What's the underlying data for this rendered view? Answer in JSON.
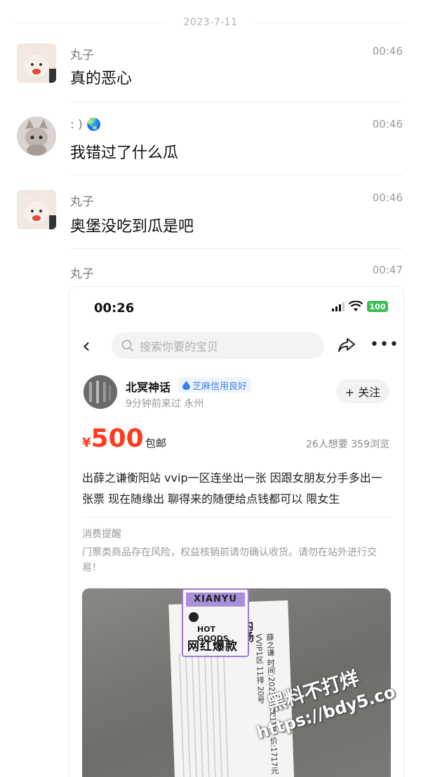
{
  "date_separator": "2023-7-11",
  "messages": [
    {
      "sender": "丸子",
      "time": "00:46",
      "text": "真的恶心"
    },
    {
      "sender": ": )",
      "sender_emoji": "🌏",
      "time": "00:46",
      "text": "我错过了什么瓜"
    },
    {
      "sender": "丸子",
      "time": "00:46",
      "text": "奥堡没吃到瓜是吧"
    },
    {
      "sender": "丸子",
      "time": "00:47"
    }
  ],
  "listing": {
    "status_time": "00:26",
    "battery": "100",
    "search_placeholder": "搜索你要的宝贝",
    "seller_name": "北冥神话",
    "credit_badge": "芝麻信用良好",
    "seller_meta": "9分钟前来过  永州",
    "follow_label": "+ 关注",
    "price_symbol": "¥",
    "price": "500",
    "shipping": "包邮",
    "stats": "26人想要  359浏览",
    "description": "出薛之谦衡阳站 vvip一区连坐出一张  因跟女朋友分手多出一张票 现在随缘出 聊得来的随便给点钱都可以 限女生",
    "reminder_title": "消费提醒",
    "reminder_text": "门票类商品存在风险，权益核销前请勿确认收货。请勿在站外进行交易！",
    "photo": {
      "sticker_top": "XIANYU",
      "sticker_hot": "HOT GOODS",
      "sticker_main": "网红爆款",
      "ticket_title": "内场",
      "ticket_info": "薛之谦 时间:2023年7月15日 价:1717元 VVIP1区 11排 20号"
    }
  },
  "watermark": {
    "line1": "黑料不打烊",
    "line2": "https://bdy5.co"
  },
  "colors": {
    "price": "#ff3b1f",
    "credit": "#3f7fe8",
    "battery": "#3dbf55"
  }
}
